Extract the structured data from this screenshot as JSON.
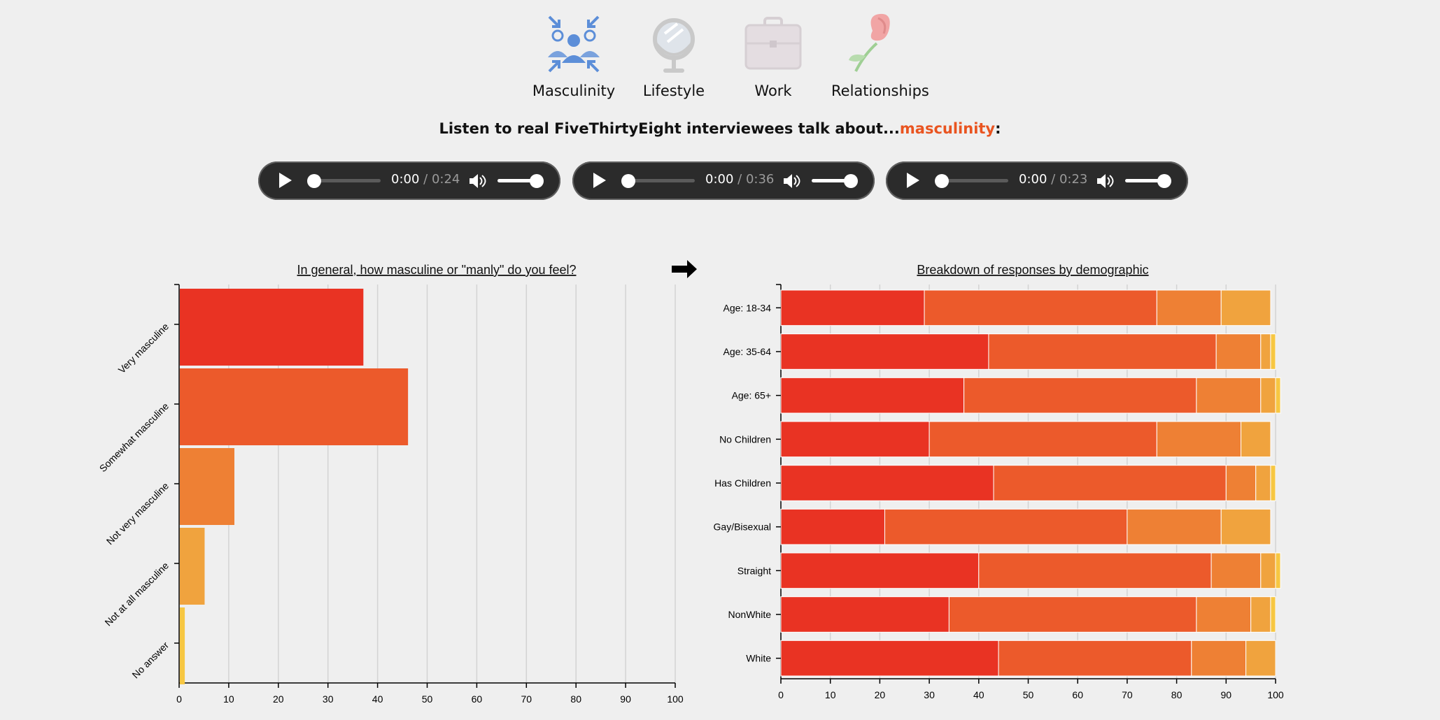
{
  "nav": {
    "items": [
      {
        "label": "Masculinity",
        "icon": "people-converge-icon"
      },
      {
        "label": "Lifestyle",
        "icon": "mirror-icon"
      },
      {
        "label": "Work",
        "icon": "briefcase-icon"
      },
      {
        "label": "Relationships",
        "icon": "rose-icon"
      }
    ]
  },
  "heading": {
    "prefix": "Listen to real FiveThirtyEight interviewees talk about...",
    "topic": "masculinity",
    "suffix": ":"
  },
  "players": [
    {
      "current": "0:00",
      "duration": "/ 0:24"
    },
    {
      "current": "0:00",
      "duration": "/ 0:36"
    },
    {
      "current": "0:00",
      "duration": "/ 0:23"
    }
  ],
  "colors": {
    "c1": "#e93323",
    "c2": "#ec5a2b",
    "c3": "#ee8034",
    "c4": "#f0a33e",
    "c5": "#f7c742",
    "topic": "#e95420"
  },
  "chart_data": [
    {
      "type": "bar",
      "orientation": "horizontal",
      "title": "In general, how masculine or \"manly\" do you feel?",
      "categories": [
        "Very masculine",
        "Somewhat masculine",
        "Not very masculine",
        "Not at all masculine",
        "No answer"
      ],
      "values": [
        37,
        46,
        11,
        5,
        1
      ],
      "xlim": [
        0,
        100
      ],
      "xticks": [
        0,
        10,
        20,
        30,
        40,
        50,
        60,
        70,
        80,
        90,
        100
      ],
      "grid": true
    },
    {
      "type": "bar",
      "orientation": "horizontal",
      "stacked": true,
      "title": "Breakdown of responses by demographic",
      "categories": [
        "Age: 18-34",
        "Age: 35-64",
        "Age: 65+",
        "No Children",
        "Has Children",
        "Gay/Bisexual",
        "Straight",
        "NonWhite",
        "White"
      ],
      "series": [
        {
          "values": [
            29,
            42,
            37,
            30,
            43,
            21,
            40,
            34,
            44
          ]
        },
        {
          "values": [
            47,
            46,
            47,
            46,
            47,
            49,
            47,
            50,
            39
          ]
        },
        {
          "values": [
            13,
            9,
            13,
            17,
            6,
            19,
            10,
            11,
            11
          ]
        },
        {
          "values": [
            10,
            2,
            3,
            6,
            3,
            10,
            3,
            4,
            6
          ]
        },
        {
          "values": [
            0,
            1,
            1,
            0,
            1,
            0,
            1,
            1,
            0
          ]
        }
      ],
      "xlim": [
        0,
        100
      ],
      "xticks": [
        0,
        10,
        20,
        30,
        40,
        50,
        60,
        70,
        80,
        90,
        100
      ],
      "grid": true
    }
  ]
}
